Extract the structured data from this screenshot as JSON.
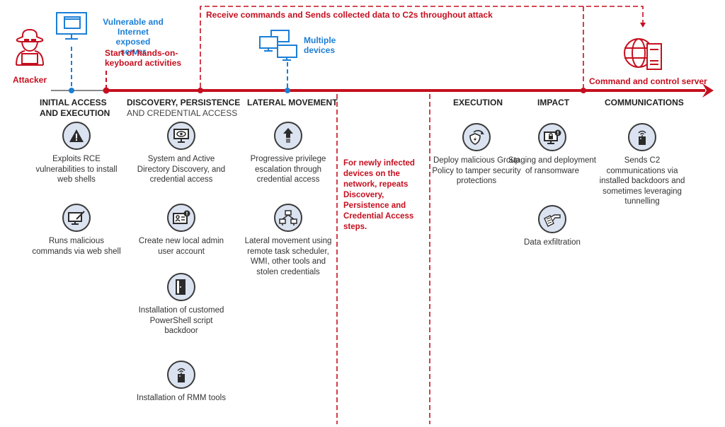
{
  "colors": {
    "threat_red": "#c50f1f",
    "device_blue": "#1b7fd6",
    "icon_fill": "#dbe3f1",
    "text": "#333333"
  },
  "attacker": {
    "label": "Attacker",
    "icon": "hacker-icon"
  },
  "server": {
    "label_lines": [
      "Vulnerable and",
      "Internet exposed",
      "server"
    ],
    "icon": "monitor-icon"
  },
  "hands_on": {
    "label_lines": [
      "Start of hands-on-",
      "keyboard activities"
    ]
  },
  "c2_loop": {
    "label": "Receive commands and Sends collected data to C2s throughout attack"
  },
  "devices": {
    "label_lines": [
      "Multiple",
      "devices"
    ],
    "icon": "multiple-devices-icon"
  },
  "c2_server": {
    "label": "Command and control server",
    "icon": "globe-server-icon"
  },
  "stages": [
    {
      "title": "INITIAL ACCESS",
      "title2": "AND EXECUTION",
      "sub": ""
    },
    {
      "title": "DISCOVERY, PERSISTENCE",
      "title2": "",
      "sub": "AND CREDENTIAL ACCESS"
    },
    {
      "title": "LATERAL MOVEMENT",
      "title2": "",
      "sub": ""
    },
    {
      "title": "EXECUTION",
      "title2": "",
      "sub": ""
    },
    {
      "title": "IMPACT",
      "title2": "",
      "sub": ""
    },
    {
      "title": "COMMUNICATIONS",
      "title2": "",
      "sub": ""
    }
  ],
  "items": {
    "initial": [
      {
        "icon": "warning-icon",
        "text": "Exploits RCE vulnerabilities to install web shells"
      },
      {
        "icon": "web-shell-icon",
        "text": "Runs malicious commands via web shell"
      }
    ],
    "discovery": [
      {
        "icon": "monitor-eye-icon",
        "text": "System and Active Directory Discovery, and credential access"
      },
      {
        "icon": "id-card-alert-icon",
        "text": "Create new local admin user account"
      },
      {
        "icon": "door-icon",
        "text": "Installation of customed PowerShell script backdoor"
      },
      {
        "icon": "remote-device-icon",
        "text": "Installation of RMM tools"
      }
    ],
    "lateral": [
      {
        "icon": "up-arrow-icon",
        "text": "Progressive privilege escalation through credential access"
      },
      {
        "icon": "network-icon",
        "text": "Lateral movement using remote task scheduler, WMI, other tools and stolen credentials"
      }
    ],
    "execution": [
      {
        "icon": "shield-refresh-icon",
        "text": "Deploy malicious Group Policy to tamper security protections"
      }
    ],
    "impact": [
      {
        "icon": "lock-monitor-icon",
        "text": "Staging and deployment of ransomware"
      },
      {
        "icon": "hand-document-icon",
        "text": "Data exfiltration"
      }
    ],
    "communications": [
      {
        "icon": "remote-device-icon",
        "text": "Sends C2 communications via installed backdoors and sometimes leveraging tunnelling"
      }
    ]
  },
  "repeat_note": "For newly infected devices on the network, repeats Discovery, Persistence and Credential Access steps."
}
